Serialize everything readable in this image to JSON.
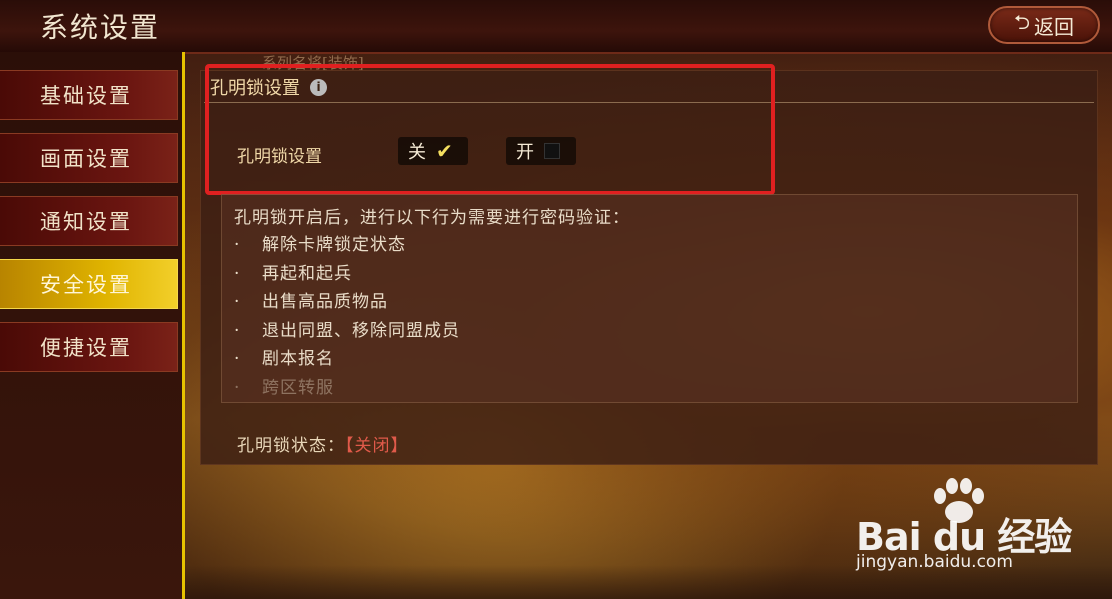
{
  "app": {
    "title": "系统设置",
    "back_label": "返回"
  },
  "sidebar": {
    "items": [
      {
        "label": "基础设置",
        "active": false
      },
      {
        "label": "画面设置",
        "active": false
      },
      {
        "label": "通知设置",
        "active": false
      },
      {
        "label": "安全设置",
        "active": true
      },
      {
        "label": "便捷设置",
        "active": false
      }
    ]
  },
  "scroll_hint": "系列名将[装饰]",
  "section": {
    "title": "孔明锁设置",
    "lock_label": "孔明锁设置",
    "option_off": {
      "label": "关",
      "selected": true
    },
    "option_on": {
      "label": "开",
      "selected": false
    }
  },
  "description": {
    "intro": "孔明锁开启后，进行以下行为需要进行密码验证：",
    "bullet": "·",
    "items": [
      "解除卡牌锁定状态",
      "再起和起兵",
      "出售高品质物品",
      "退出同盟、移除同盟成员",
      "剧本报名",
      "跨区转服"
    ]
  },
  "status": {
    "label": "孔明锁状态：",
    "value": "【关闭】"
  },
  "watermark": {
    "logo": "Bai du 经验",
    "url": "jingyan.baidu.com"
  },
  "colors": {
    "highlight_frame": "#e02020",
    "active_tab": "#e0b400",
    "status_value": "#e05a4a"
  }
}
